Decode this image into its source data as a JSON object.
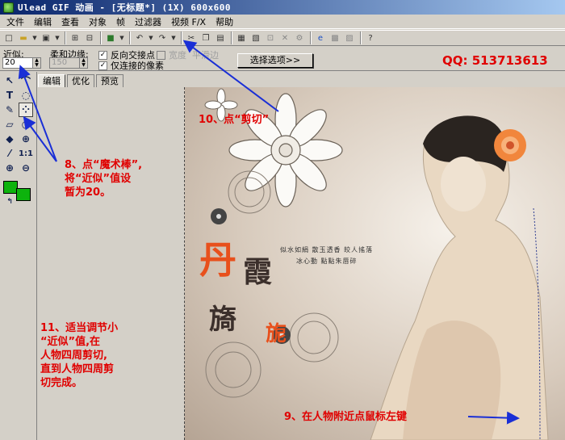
{
  "window": {
    "title": "Ulead GIF 动画 - [无标题*] (1X) 600x600"
  },
  "menu": [
    "文件",
    "编辑",
    "查看",
    "对象",
    "帧",
    "过滤器",
    "视频 F/X",
    "帮助"
  ],
  "options": {
    "approx_label": "近似:",
    "approx_value": "20",
    "feather_label": "柔和边缘:",
    "feather_value": "150",
    "invert_label": "反向交接点",
    "invert_checked": "✓",
    "tolerance_label": "宽度",
    "antialias_label": "平滑边",
    "connected_label": "仅连接的像素",
    "connected_checked": "✓",
    "select_button": "选择选项>>"
  },
  "qq": "QQ: 513713613",
  "tabs": [
    "编辑",
    "优化",
    "预览"
  ],
  "annotations": {
    "step10": "10、点“剪切”",
    "step8_line1": "8、点“魔术棒”,",
    "step8_line2": "将“近似”值设",
    "step8_line3": "暂为20。",
    "step11_line1": "11、适当调节小",
    "step11_line2": "“近似”值,在",
    "step11_line3": "人物四周剪切,",
    "step11_line4": "直到人物四周剪",
    "step11_line5": "切完成。",
    "step9": "9、在人物附近点鼠标左键"
  },
  "artwork": {
    "char1": "丹",
    "char2": "霞",
    "char3": "旖",
    "char4": "旎",
    "poem_line1": "似水如絹  散玉透香  皎人搖落",
    "poem_line2": "冰心動  點點朱唇碎"
  },
  "colors": {
    "annotation": "#e00000",
    "arrow": "#1a2fd6",
    "swatch": "#0db30d"
  },
  "palette_icons": [
    "pointer-icon",
    "lasso-icon",
    "text-icon",
    "ellipse-select-icon",
    "brush-icon",
    "magic-wand-icon",
    "eraser-icon",
    "oval-icon",
    "fill-icon",
    "clone-icon",
    "eyedropper-icon",
    "ratio-icon",
    "zoom-in-icon",
    "zoom-out-icon"
  ]
}
